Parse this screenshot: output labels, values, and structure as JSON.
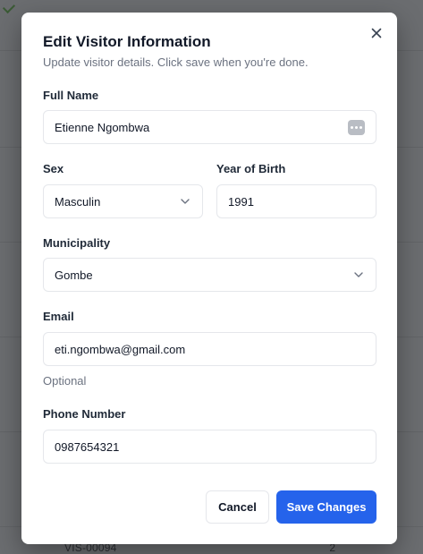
{
  "background": {
    "row_id_fragment": "VIS-00094",
    "row_count_fragment": "2"
  },
  "dialog": {
    "title": "Edit Visitor Information",
    "description": "Update visitor details. Click save when you're done.",
    "close_icon": "close-icon"
  },
  "form": {
    "full_name": {
      "label": "Full Name",
      "value": "Etienne Ngombwa",
      "icon": "more-dots-icon"
    },
    "sex": {
      "label": "Sex",
      "value": "Masculin",
      "icon": "chevron-down-icon"
    },
    "year_of_birth": {
      "label": "Year of Birth",
      "value": "1991"
    },
    "municipality": {
      "label": "Municipality",
      "value": "Gombe",
      "icon": "chevron-down-icon"
    },
    "email": {
      "label": "Email",
      "value": "eti.ngombwa@gmail.com",
      "hint": "Optional"
    },
    "phone": {
      "label": "Phone Number",
      "value": "0987654321"
    }
  },
  "actions": {
    "cancel_label": "Cancel",
    "save_label": "Save Changes"
  },
  "colors": {
    "primary": "#2563eb",
    "overlay": "#6b6d70",
    "muted_text": "#6b7280",
    "border": "#e5e7eb"
  }
}
